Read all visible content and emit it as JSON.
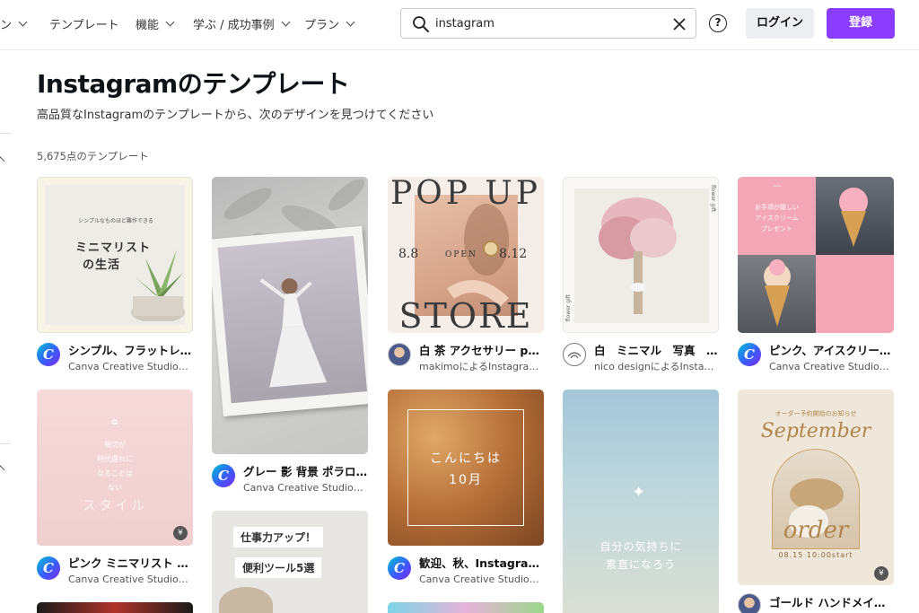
{
  "nav": {
    "partial_item": "ン",
    "templates": "テンプレート",
    "features": "機能",
    "learn": "学ぶ / 成功事例",
    "plans": "プラン"
  },
  "search": {
    "value": "instagram"
  },
  "header": {
    "help": "?",
    "login": "ログイン",
    "signup": "登録"
  },
  "page": {
    "title": "Instagramのテンプレート",
    "subtitle": "高品質なInstagramのテンプレートから、次のデザインを見つけてください",
    "count": "5,675点のテンプレート"
  },
  "cards": [
    {
      "title": "シンプル、フラットレ…",
      "author": "Canva Creative Studioによ…",
      "text_line1": "シンプルなものほど難作できる",
      "text_line2": "ミニマリスト",
      "text_line3": "の生活"
    },
    {
      "title": "グレー 影 背景 ポラロイ…",
      "author": "Canva Creative Studioによ…"
    },
    {
      "title": "白 茶 アクセサリー pop…",
      "author": "makimoによるInstagramの…",
      "text_top": "POP UP",
      "text_mid_left": "8.8",
      "text_mid_center": "OPEN",
      "text_mid_right": "8.12",
      "text_bottom": "STORE"
    },
    {
      "title": "白　ミニマル　写真　…",
      "author": "nico designによるInstagra…",
      "side_text_1": "flower gift",
      "side_text_2": "flower gift"
    },
    {
      "title": "ピンク、アイスクリー…",
      "author": "Canva Creative Studioによ…",
      "text_top": "お手頃が嬉しい",
      "text_line2": "アイスクリーム",
      "text_line3": "プレゼント"
    },
    {
      "title": "ピンク ミニマリスト 親…",
      "author": "Canva Creative Studioによ…",
      "text_line1": "親切が",
      "text_line2": "時代遅れに",
      "text_line3": "なることは",
      "text_line4": "ない",
      "text_line5": "スタイル",
      "badge": "¥"
    },
    {
      "title": "",
      "author": "",
      "text_line1": "仕事力アップ！",
      "text_line2": "便利ツール5選"
    },
    {
      "title": "歓迎、秋、Instagram…",
      "author": "Canva Creative Studioによ…",
      "text_line1": "こんにちは",
      "text_line2": "10月"
    },
    {
      "title": "",
      "author": "",
      "text_line1": "自分の気持ちに",
      "text_line2": "素直になろう"
    },
    {
      "title": "ゴールド ハンドメイド …",
      "author": "",
      "text_top": "オーダー予約開始のお知らせ",
      "text_line2": "September",
      "text_line3": "order",
      "text_line4": "08.15 10:00start",
      "badge": "¥"
    }
  ],
  "colors": {
    "accent": "#8b3dff",
    "login_bg": "#eceef1"
  },
  "icons": [
    "search-icon",
    "clear-icon",
    "help-icon",
    "chevron-down-icon",
    "canva-logo-icon",
    "premium-badge-icon"
  ]
}
